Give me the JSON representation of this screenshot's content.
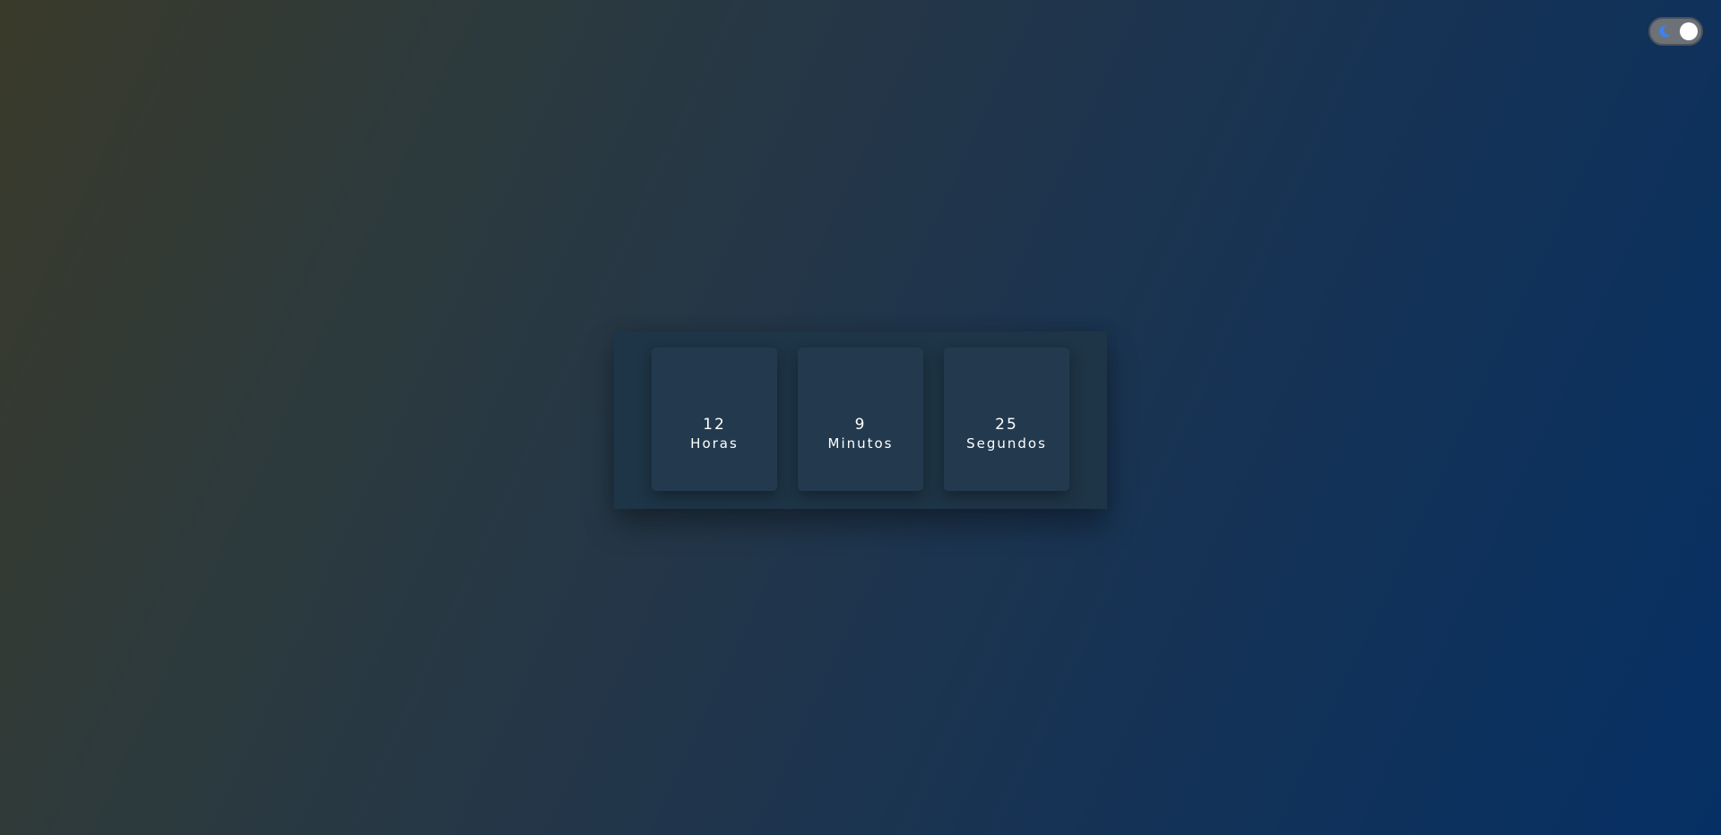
{
  "theme_toggle": {
    "icon": "moon-icon",
    "state": "dark",
    "accent_color": "#3b82f6"
  },
  "timer": {
    "hours": {
      "value": "12",
      "label": "Horas"
    },
    "minutes": {
      "value": "9",
      "label": "Minutos"
    },
    "seconds": {
      "value": "25",
      "label": "Segundos"
    }
  }
}
